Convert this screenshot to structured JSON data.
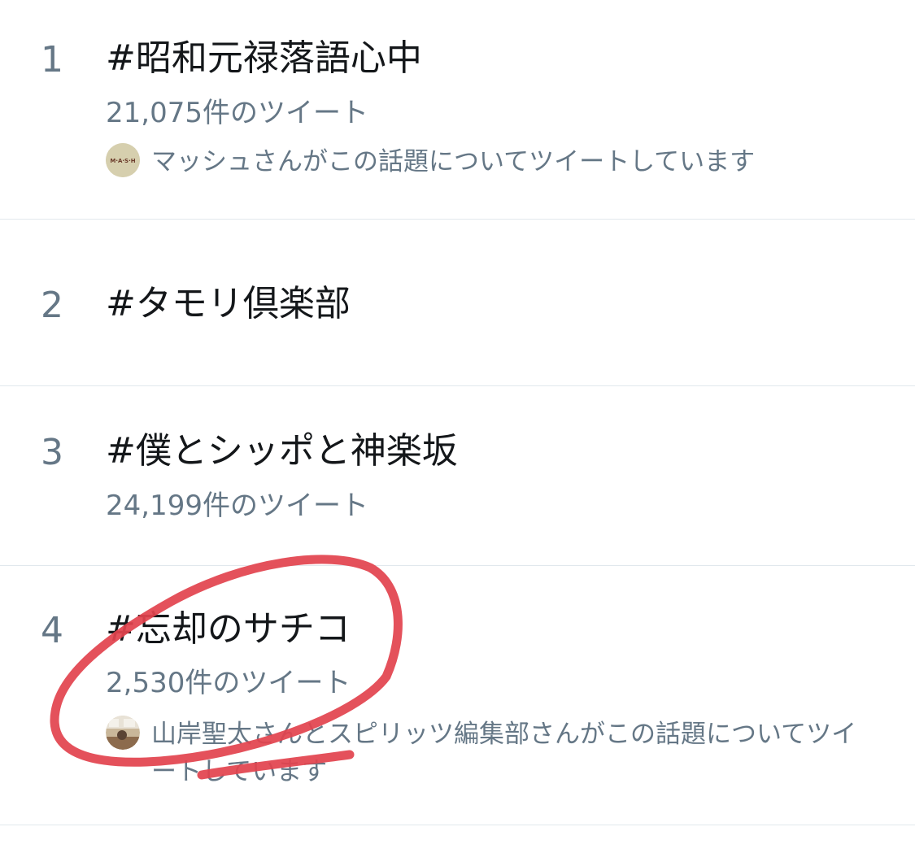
{
  "trends": [
    {
      "rank": "1",
      "topic": "#昭和元禄落語心中",
      "tweet_count": "21,075件のツイート",
      "context": "マッシュさんがこの話題についてツイートしています",
      "avatar_icon": "mash-logo-avatar"
    },
    {
      "rank": "2",
      "topic": "#タモリ倶楽部"
    },
    {
      "rank": "3",
      "topic": "#僕とシッポと神楽坂",
      "tweet_count": "24,199件のツイート"
    },
    {
      "rank": "4",
      "topic": "#忘却のサチコ",
      "tweet_count": "2,530件のツイート",
      "context": "山岸聖太さんとスピリッツ編集部さんがこの話題についてツイートしています",
      "avatar_icon": "user-photo-avatar"
    }
  ],
  "avatar_logo_text": "M·A·S·H",
  "colors": {
    "primary_text": "#14171a",
    "secondary_text": "#657786",
    "divider": "#e1e8ed",
    "annotation_red": "#e2444f",
    "avatar_bg": "#d6cfae"
  }
}
